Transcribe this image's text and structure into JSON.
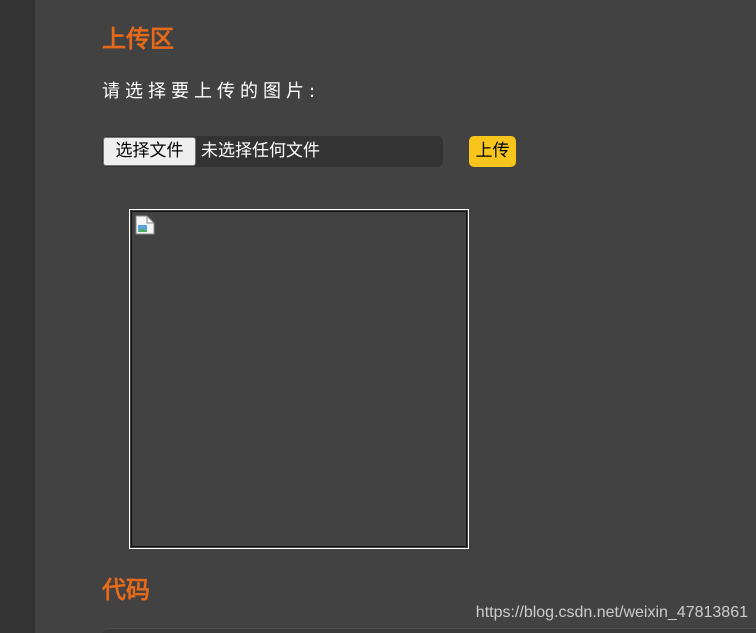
{
  "upload_section": {
    "title": "上传区",
    "prompt": "请选择要上传的图片:",
    "file_input": {
      "button_label": "选择文件",
      "status_text": "未选择任何文件"
    },
    "upload_button_label": "上传",
    "preview": {
      "icon": "broken-image-icon"
    }
  },
  "code_section": {
    "title": "代码"
  },
  "watermark": "https://blog.csdn.net/weixin_47813861",
  "colors": {
    "background": "#424242",
    "gutter": "#333333",
    "heading": "#e66a1a",
    "upload_button": "#f7c51b"
  }
}
